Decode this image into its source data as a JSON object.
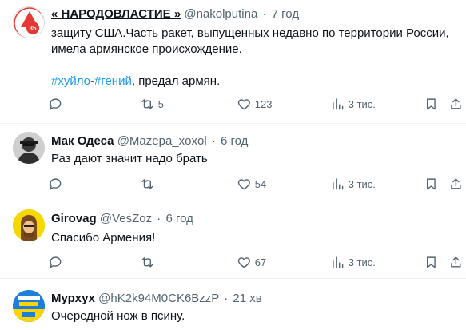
{
  "tweets": [
    {
      "name": "« НАРОДОВЛАСТИЕ »",
      "handle": "@nakolputina",
      "sep": "·",
      "time": "7 год",
      "avatar": {
        "style": "logo",
        "label": "35",
        "colors": {
          "ring": "#e53935",
          "bg": "#ffffff"
        }
      },
      "lines": [
        "защиту США.Часть ракет, выпущенных недавно по территории России,",
        "имела армянское происхождение."
      ],
      "hashtag_line": {
        "tag1": "#хуйло",
        "dash": "-",
        "tag2": "#гений",
        "rest": ", предал армян."
      },
      "stats": {
        "replies": "",
        "retweets": "5",
        "likes": "123",
        "views": "3 тис."
      }
    },
    {
      "name": "Мак Одеса",
      "handle": "@Mazepa_xoxol",
      "sep": "·",
      "time": "6 год",
      "avatar": {
        "style": "photo-dark"
      },
      "lines": [
        "Раз дают значит надо брать"
      ],
      "stats": {
        "replies": "",
        "retweets": "",
        "likes": "54",
        "views": "3 тис."
      }
    },
    {
      "name": "Girovag",
      "handle": "@VesZoz",
      "sep": "·",
      "time": "6 год",
      "avatar": {
        "style": "cartoon-yellow"
      },
      "lines": [
        "Спасибо Армения!"
      ],
      "stats": {
        "replies": "",
        "retweets": "",
        "likes": "67",
        "views": "3 тис."
      }
    },
    {
      "name": "Мурхух",
      "handle": "@hK2k94M0CK6BzzP",
      "sep": "·",
      "time": "21 хв",
      "avatar": {
        "style": "poster-blue"
      },
      "lines": [
        "Очередной нож в псину."
      ]
    }
  ],
  "colors": {
    "accent": "#1d9bf0",
    "muted": "#536471",
    "text": "#0f1419",
    "divider": "#eff3f4"
  },
  "icons": [
    "reply-icon",
    "retweet-icon",
    "like-icon",
    "views-icon",
    "bookmark-icon",
    "share-icon"
  ]
}
